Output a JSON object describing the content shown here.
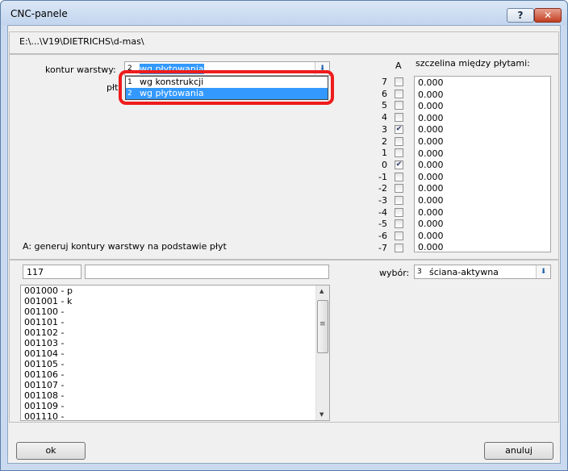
{
  "window": {
    "title": "CNC-panele"
  },
  "path": "E:\\...\\V19\\DIETRICHS\\d-mas\\",
  "kontur": {
    "label": "kontur warstwy:",
    "selected_num": "2",
    "selected_text": "wg płytowania",
    "options": [
      {
        "num": "1",
        "text": "wg konstrukcji"
      },
      {
        "num": "2",
        "text": "wg płytowania"
      }
    ]
  },
  "plyt_label": "płt",
  "a_header": "A",
  "gap_header": "szczelina między płytami:",
  "levels": [
    {
      "n": "7",
      "checked": false,
      "v": "0.000"
    },
    {
      "n": "6",
      "checked": false,
      "v": "0.000"
    },
    {
      "n": "5",
      "checked": false,
      "v": "0.000"
    },
    {
      "n": "4",
      "checked": false,
      "v": "0.000"
    },
    {
      "n": "3",
      "checked": true,
      "v": "0.000"
    },
    {
      "n": "2",
      "checked": false,
      "v": "0.000"
    },
    {
      "n": "1",
      "checked": false,
      "v": "0.000"
    },
    {
      "n": "0",
      "checked": true,
      "v": "0.000"
    },
    {
      "n": "-1",
      "checked": false,
      "v": "0.000"
    },
    {
      "n": "-2",
      "checked": false,
      "v": "0.000"
    },
    {
      "n": "-3",
      "checked": false,
      "v": "0.000"
    },
    {
      "n": "-4",
      "checked": false,
      "v": "0.000"
    },
    {
      "n": "-5",
      "checked": false,
      "v": "0.000"
    },
    {
      "n": "-6",
      "checked": false,
      "v": "0.000"
    },
    {
      "n": "-7",
      "checked": false,
      "v": "0.000"
    }
  ],
  "note": "A: generuj kontury warstwy na podstawie płyt",
  "count_value": "117",
  "name_value": "",
  "items": [
    "001000 - p",
    "001001 - k",
    "001100 -",
    "001101 -",
    "001102 -",
    "001103 -",
    "001104 -",
    "001105 -",
    "001106 -",
    "001107 -",
    "001108 -",
    "001109 -",
    "001110 -"
  ],
  "wybor": {
    "label": "wybór:",
    "num": "3",
    "text": "ściana-aktywna"
  },
  "buttons": {
    "ok": "ok",
    "cancel": "anuluj"
  }
}
